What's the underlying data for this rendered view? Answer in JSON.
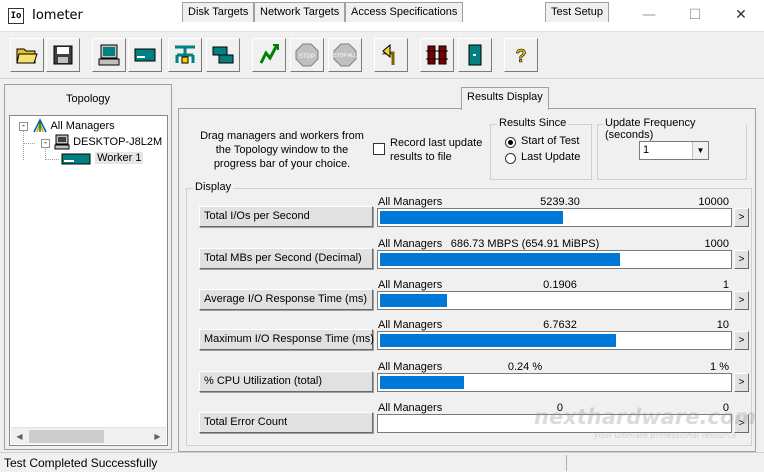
{
  "window": {
    "title": "Iometer",
    "icon_text": "Io",
    "minimize_glyph": "—",
    "maximize_glyph": "☐",
    "close_glyph": "✕"
  },
  "toolbar": {
    "buttons": [
      {
        "icon": "open-folder-icon"
      },
      {
        "icon": "save-icon"
      },
      {
        "icon": "new-manager-icon"
      },
      {
        "icon": "new-worker-disk-icon"
      },
      {
        "icon": "new-network-worker-icon"
      },
      {
        "icon": "copy-worker-icon"
      },
      {
        "icon": "start-tests-icon"
      },
      {
        "icon": "stop-icon",
        "label": "STOP"
      },
      {
        "icon": "stop-all-icon",
        "label": "STOP ALL"
      },
      {
        "icon": "reset-workers-icon"
      },
      {
        "icon": "disconnect-icon"
      },
      {
        "icon": "exit-icon"
      },
      {
        "icon": "help-icon"
      }
    ]
  },
  "topology": {
    "title": "Topology",
    "items": [
      {
        "label": "All Managers",
        "icon": "all-managers-icon",
        "expander": "-"
      },
      {
        "label": "DESKTOP-J8L2M",
        "icon": "computer-icon",
        "expander": "-"
      },
      {
        "label": "Worker 1",
        "icon": "worker-disk-icon"
      }
    ],
    "scroll_left": "◀",
    "scroll_right": "▶"
  },
  "tabs": [
    {
      "label": "Disk Targets"
    },
    {
      "label": "Network Targets"
    },
    {
      "label": "Access Specifications"
    },
    {
      "label": "Results Display",
      "active": true
    },
    {
      "label": "Test Setup"
    }
  ],
  "results": {
    "drag_text": "Drag managers and workers from the Topology window to the progress bar of your choice.",
    "record_label": "Record last update results to file",
    "record_checked": false,
    "results_since": {
      "legend": "Results Since",
      "options": [
        "Start of Test",
        "Last Update"
      ],
      "selected": "Start of Test"
    },
    "update_frequency": {
      "legend": "Update Frequency (seconds)",
      "value": "1",
      "dropdown_glyph": "▼"
    },
    "display_legend": "Display",
    "arrow_glyph": ">",
    "metrics": [
      {
        "name": "Total I/Os per Second",
        "source": "All Managers",
        "value": "5239.30",
        "max": "10000",
        "fill": 0.524
      },
      {
        "name": "Total MBs per Second (Decimal)",
        "source": "All Managers",
        "value": "686.73 MBPS (654.91 MiBPS)",
        "max": "1000",
        "fill": 0.687
      },
      {
        "name": "Average I/O Response Time (ms)",
        "source": "All Managers",
        "value": "0.1906",
        "max": "1",
        "fill": 0.191
      },
      {
        "name": "Maximum I/O Response Time (ms)",
        "source": "All Managers",
        "value": "6.7632",
        "max": "10",
        "fill": 0.676
      },
      {
        "name": "% CPU Utilization (total)",
        "source": "All Managers",
        "value": "0.24 %",
        "max": "1 %",
        "fill": 0.24
      },
      {
        "name": "Total Error Count",
        "source": "All Managers",
        "value": "0",
        "max": "0",
        "fill": 0
      }
    ]
  },
  "status": {
    "text": "Test Completed Successfully"
  },
  "watermark": {
    "main": "nexthardware.com",
    "sub": "your ultimate professional resource"
  },
  "colors": {
    "progress": "#0078d7",
    "window_bg": "#f0f0f0"
  }
}
